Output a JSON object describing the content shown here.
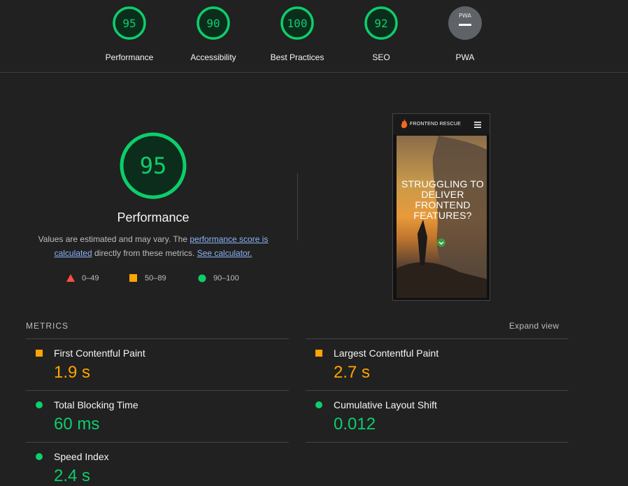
{
  "gauges": [
    {
      "label": "Performance",
      "score": "95",
      "color": "#0cce6b"
    },
    {
      "label": "Accessibility",
      "score": "90",
      "color": "#0cce6b"
    },
    {
      "label": "Best Practices",
      "score": "100",
      "color": "#0cce6b"
    },
    {
      "label": "SEO",
      "score": "92",
      "color": "#0cce6b"
    },
    {
      "label": "PWA",
      "badge": "PWA",
      "color": "#5f6368"
    }
  ],
  "performance": {
    "score": "95",
    "title": "Performance",
    "desc_prefix": "Values are estimated and may vary. The ",
    "desc_link1": "performance score is calculated",
    "desc_middle": " directly from these metrics. ",
    "desc_link2": "See calculator."
  },
  "legend": [
    {
      "range": "0–49",
      "color": "#ff4e42",
      "shape": "triangle"
    },
    {
      "range": "50–89",
      "color": "#ffa400",
      "shape": "square"
    },
    {
      "range": "90–100",
      "color": "#0cce6b",
      "shape": "circle"
    }
  ],
  "screenshot": {
    "brand": "FRONTEND RESCUE",
    "hero_text": "STRUGGLING TO DELIVER FRONTEND FEATURES?"
  },
  "metrics": {
    "title": "METRICS",
    "expand_label": "Expand view",
    "items": [
      {
        "label": "First Contentful Paint",
        "value": "1.9 s",
        "status": "average"
      },
      {
        "label": "Largest Contentful Paint",
        "value": "2.7 s",
        "status": "average"
      },
      {
        "label": "Total Blocking Time",
        "value": "60 ms",
        "status": "pass"
      },
      {
        "label": "Cumulative Layout Shift",
        "value": "0.012",
        "status": "pass"
      },
      {
        "label": "Speed Index",
        "value": "2.4 s",
        "status": "pass"
      }
    ]
  }
}
